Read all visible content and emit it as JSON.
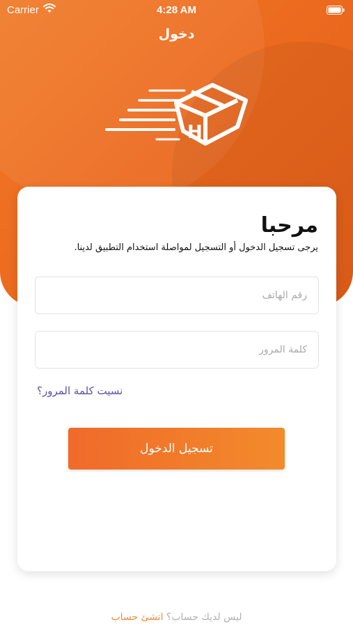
{
  "status": {
    "carrier": "Carrier",
    "time": "4:28 AM",
    "icons": [
      "wifi-icon",
      "battery-icon"
    ]
  },
  "header": {
    "title": "دخول"
  },
  "logo": {
    "icon": "box-delivery-logo-icon",
    "letter": "H"
  },
  "card": {
    "welcome": "مرحبا",
    "subtitle": "يرجى تسجيل الدخول أو التسجيل لمواصلة استخدام التطبيق لدينا."
  },
  "form": {
    "phone_value": "",
    "phone_placeholder": "رقم الهاتف",
    "password_value": "",
    "password_placeholder": "كلمة المرور",
    "forgot_label": "نسيت كلمة المرور؟",
    "login_label": "تسجيل الدخول"
  },
  "footer": {
    "question": "ليس لديك حساب؟",
    "create_label": "انشئ حساب"
  },
  "colors": {
    "accent": "#ec6b1f",
    "link": "#5b4fa8",
    "footer_link": "#f08a3b"
  }
}
